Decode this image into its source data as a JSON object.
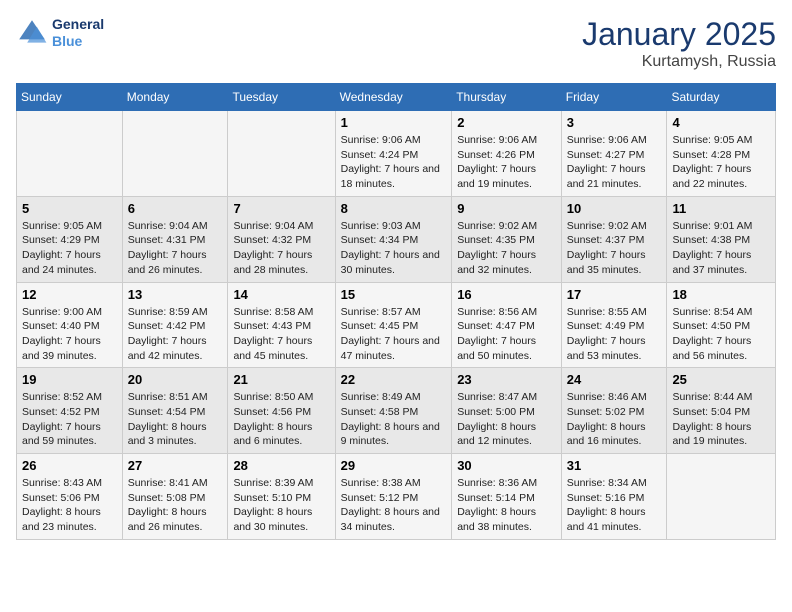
{
  "header": {
    "logo_line1": "General",
    "logo_line2": "Blue",
    "month": "January 2025",
    "location": "Kurtamysh, Russia"
  },
  "weekdays": [
    "Sunday",
    "Monday",
    "Tuesday",
    "Wednesday",
    "Thursday",
    "Friday",
    "Saturday"
  ],
  "weeks": [
    [
      {
        "day": "",
        "sunrise": "",
        "sunset": "",
        "daylight": ""
      },
      {
        "day": "",
        "sunrise": "",
        "sunset": "",
        "daylight": ""
      },
      {
        "day": "",
        "sunrise": "",
        "sunset": "",
        "daylight": ""
      },
      {
        "day": "1",
        "sunrise": "Sunrise: 9:06 AM",
        "sunset": "Sunset: 4:24 PM",
        "daylight": "Daylight: 7 hours and 18 minutes."
      },
      {
        "day": "2",
        "sunrise": "Sunrise: 9:06 AM",
        "sunset": "Sunset: 4:26 PM",
        "daylight": "Daylight: 7 hours and 19 minutes."
      },
      {
        "day": "3",
        "sunrise": "Sunrise: 9:06 AM",
        "sunset": "Sunset: 4:27 PM",
        "daylight": "Daylight: 7 hours and 21 minutes."
      },
      {
        "day": "4",
        "sunrise": "Sunrise: 9:05 AM",
        "sunset": "Sunset: 4:28 PM",
        "daylight": "Daylight: 7 hours and 22 minutes."
      }
    ],
    [
      {
        "day": "5",
        "sunrise": "Sunrise: 9:05 AM",
        "sunset": "Sunset: 4:29 PM",
        "daylight": "Daylight: 7 hours and 24 minutes."
      },
      {
        "day": "6",
        "sunrise": "Sunrise: 9:04 AM",
        "sunset": "Sunset: 4:31 PM",
        "daylight": "Daylight: 7 hours and 26 minutes."
      },
      {
        "day": "7",
        "sunrise": "Sunrise: 9:04 AM",
        "sunset": "Sunset: 4:32 PM",
        "daylight": "Daylight: 7 hours and 28 minutes."
      },
      {
        "day": "8",
        "sunrise": "Sunrise: 9:03 AM",
        "sunset": "Sunset: 4:34 PM",
        "daylight": "Daylight: 7 hours and 30 minutes."
      },
      {
        "day": "9",
        "sunrise": "Sunrise: 9:02 AM",
        "sunset": "Sunset: 4:35 PM",
        "daylight": "Daylight: 7 hours and 32 minutes."
      },
      {
        "day": "10",
        "sunrise": "Sunrise: 9:02 AM",
        "sunset": "Sunset: 4:37 PM",
        "daylight": "Daylight: 7 hours and 35 minutes."
      },
      {
        "day": "11",
        "sunrise": "Sunrise: 9:01 AM",
        "sunset": "Sunset: 4:38 PM",
        "daylight": "Daylight: 7 hours and 37 minutes."
      }
    ],
    [
      {
        "day": "12",
        "sunrise": "Sunrise: 9:00 AM",
        "sunset": "Sunset: 4:40 PM",
        "daylight": "Daylight: 7 hours and 39 minutes."
      },
      {
        "day": "13",
        "sunrise": "Sunrise: 8:59 AM",
        "sunset": "Sunset: 4:42 PM",
        "daylight": "Daylight: 7 hours and 42 minutes."
      },
      {
        "day": "14",
        "sunrise": "Sunrise: 8:58 AM",
        "sunset": "Sunset: 4:43 PM",
        "daylight": "Daylight: 7 hours and 45 minutes."
      },
      {
        "day": "15",
        "sunrise": "Sunrise: 8:57 AM",
        "sunset": "Sunset: 4:45 PM",
        "daylight": "Daylight: 7 hours and 47 minutes."
      },
      {
        "day": "16",
        "sunrise": "Sunrise: 8:56 AM",
        "sunset": "Sunset: 4:47 PM",
        "daylight": "Daylight: 7 hours and 50 minutes."
      },
      {
        "day": "17",
        "sunrise": "Sunrise: 8:55 AM",
        "sunset": "Sunset: 4:49 PM",
        "daylight": "Daylight: 7 hours and 53 minutes."
      },
      {
        "day": "18",
        "sunrise": "Sunrise: 8:54 AM",
        "sunset": "Sunset: 4:50 PM",
        "daylight": "Daylight: 7 hours and 56 minutes."
      }
    ],
    [
      {
        "day": "19",
        "sunrise": "Sunrise: 8:52 AM",
        "sunset": "Sunset: 4:52 PM",
        "daylight": "Daylight: 7 hours and 59 minutes."
      },
      {
        "day": "20",
        "sunrise": "Sunrise: 8:51 AM",
        "sunset": "Sunset: 4:54 PM",
        "daylight": "Daylight: 8 hours and 3 minutes."
      },
      {
        "day": "21",
        "sunrise": "Sunrise: 8:50 AM",
        "sunset": "Sunset: 4:56 PM",
        "daylight": "Daylight: 8 hours and 6 minutes."
      },
      {
        "day": "22",
        "sunrise": "Sunrise: 8:49 AM",
        "sunset": "Sunset: 4:58 PM",
        "daylight": "Daylight: 8 hours and 9 minutes."
      },
      {
        "day": "23",
        "sunrise": "Sunrise: 8:47 AM",
        "sunset": "Sunset: 5:00 PM",
        "daylight": "Daylight: 8 hours and 12 minutes."
      },
      {
        "day": "24",
        "sunrise": "Sunrise: 8:46 AM",
        "sunset": "Sunset: 5:02 PM",
        "daylight": "Daylight: 8 hours and 16 minutes."
      },
      {
        "day": "25",
        "sunrise": "Sunrise: 8:44 AM",
        "sunset": "Sunset: 5:04 PM",
        "daylight": "Daylight: 8 hours and 19 minutes."
      }
    ],
    [
      {
        "day": "26",
        "sunrise": "Sunrise: 8:43 AM",
        "sunset": "Sunset: 5:06 PM",
        "daylight": "Daylight: 8 hours and 23 minutes."
      },
      {
        "day": "27",
        "sunrise": "Sunrise: 8:41 AM",
        "sunset": "Sunset: 5:08 PM",
        "daylight": "Daylight: 8 hours and 26 minutes."
      },
      {
        "day": "28",
        "sunrise": "Sunrise: 8:39 AM",
        "sunset": "Sunset: 5:10 PM",
        "daylight": "Daylight: 8 hours and 30 minutes."
      },
      {
        "day": "29",
        "sunrise": "Sunrise: 8:38 AM",
        "sunset": "Sunset: 5:12 PM",
        "daylight": "Daylight: 8 hours and 34 minutes."
      },
      {
        "day": "30",
        "sunrise": "Sunrise: 8:36 AM",
        "sunset": "Sunset: 5:14 PM",
        "daylight": "Daylight: 8 hours and 38 minutes."
      },
      {
        "day": "31",
        "sunrise": "Sunrise: 8:34 AM",
        "sunset": "Sunset: 5:16 PM",
        "daylight": "Daylight: 8 hours and 41 minutes."
      },
      {
        "day": "",
        "sunrise": "",
        "sunset": "",
        "daylight": ""
      }
    ]
  ]
}
